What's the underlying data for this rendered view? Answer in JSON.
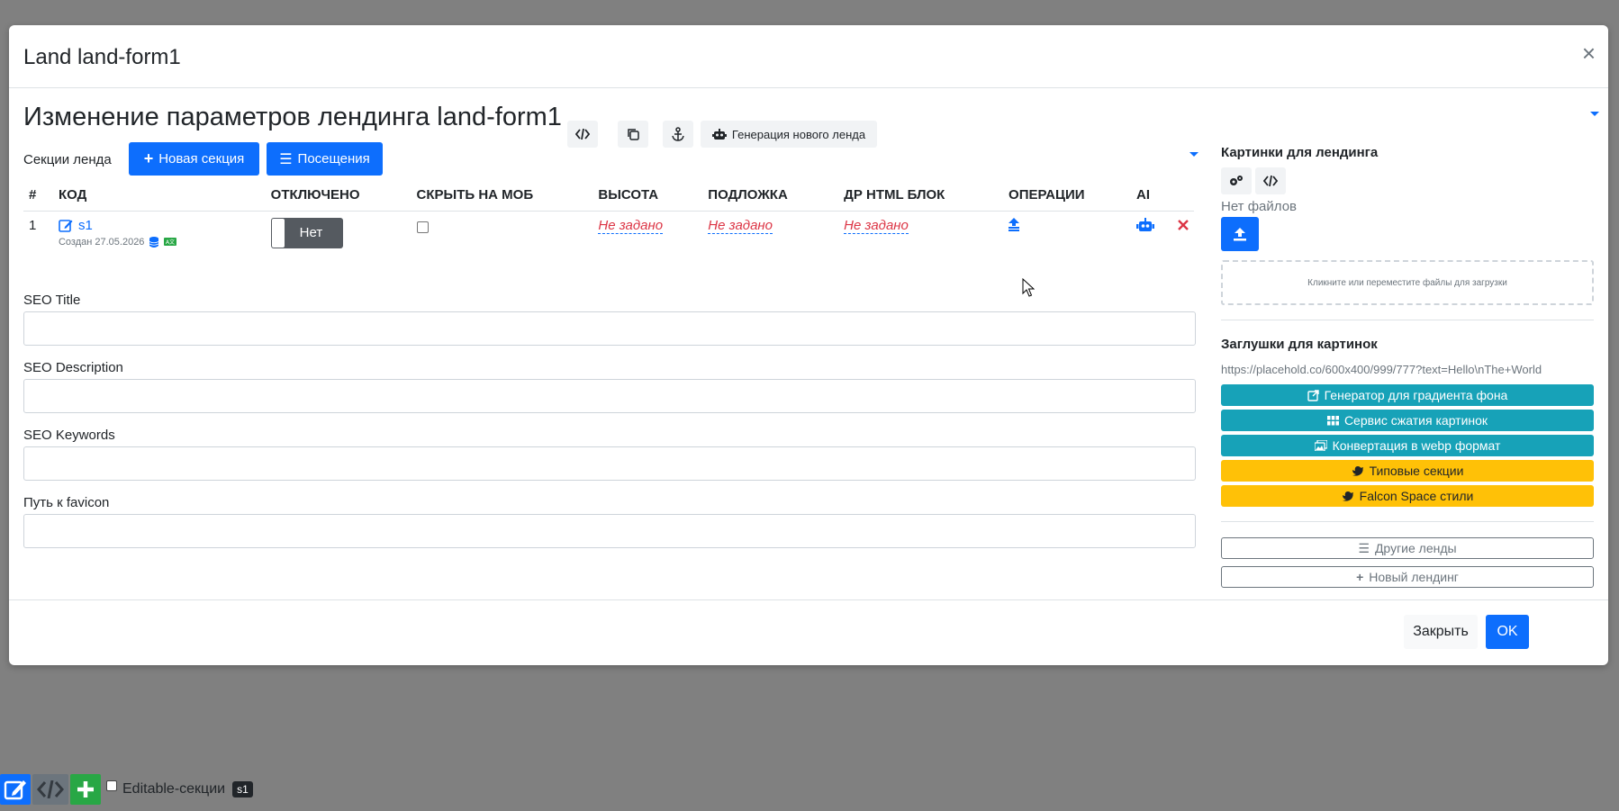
{
  "modal": {
    "title": "Land land-form1",
    "close": "×",
    "heading": "Изменение параметров лендинга land-form1",
    "gen_new_land": "Генерация нового ленда"
  },
  "sections": {
    "label": "Секции ленда",
    "new_section": "Новая секция",
    "visits": "Посещения",
    "columns": [
      "#",
      "КОД",
      "ОТКЛЮЧЕНО",
      "СКРЫТЬ НА МОБ",
      "ВЫСОТА",
      "ПОДЛОЖКА",
      "ДР HTML БЛОК",
      "ОПЕРАЦИИ",
      "AI"
    ],
    "rows": [
      {
        "num": "1",
        "code": "s1",
        "created": "Создан 27.05.2026",
        "disabled": "Нет",
        "height": "Не задано",
        "background": "Не задано",
        "html_block": "Не задано"
      }
    ]
  },
  "fields": {
    "seo_title": "SEO Title",
    "seo_description": "SEO Description",
    "seo_keywords": "SEO Keywords",
    "favicon": "Путь к favicon"
  },
  "images": {
    "title": "Картинки для лендинга",
    "no_files": "Нет файлов",
    "dropzone": "Кликните или переместите файлы для загрузки"
  },
  "placeholders": {
    "title": "Заглушки для картинок",
    "url": "https://placehold.co/600x400/999/777?text=Hello\\nThe+World",
    "gradient": "Генератор для градиента фона",
    "compress": "Сервис сжатия картинок",
    "webp": "Конвертация в webp формат",
    "typical": "Типовые секции",
    "falcon": "Falcon Space стили"
  },
  "other": {
    "other_lands": "Другие ленды",
    "new_landing": "Новый лендинг"
  },
  "footer": {
    "close": "Закрыть",
    "ok": "OK"
  },
  "bottom_bar": {
    "editable_label": "Editable-секции",
    "badge": "s1"
  }
}
